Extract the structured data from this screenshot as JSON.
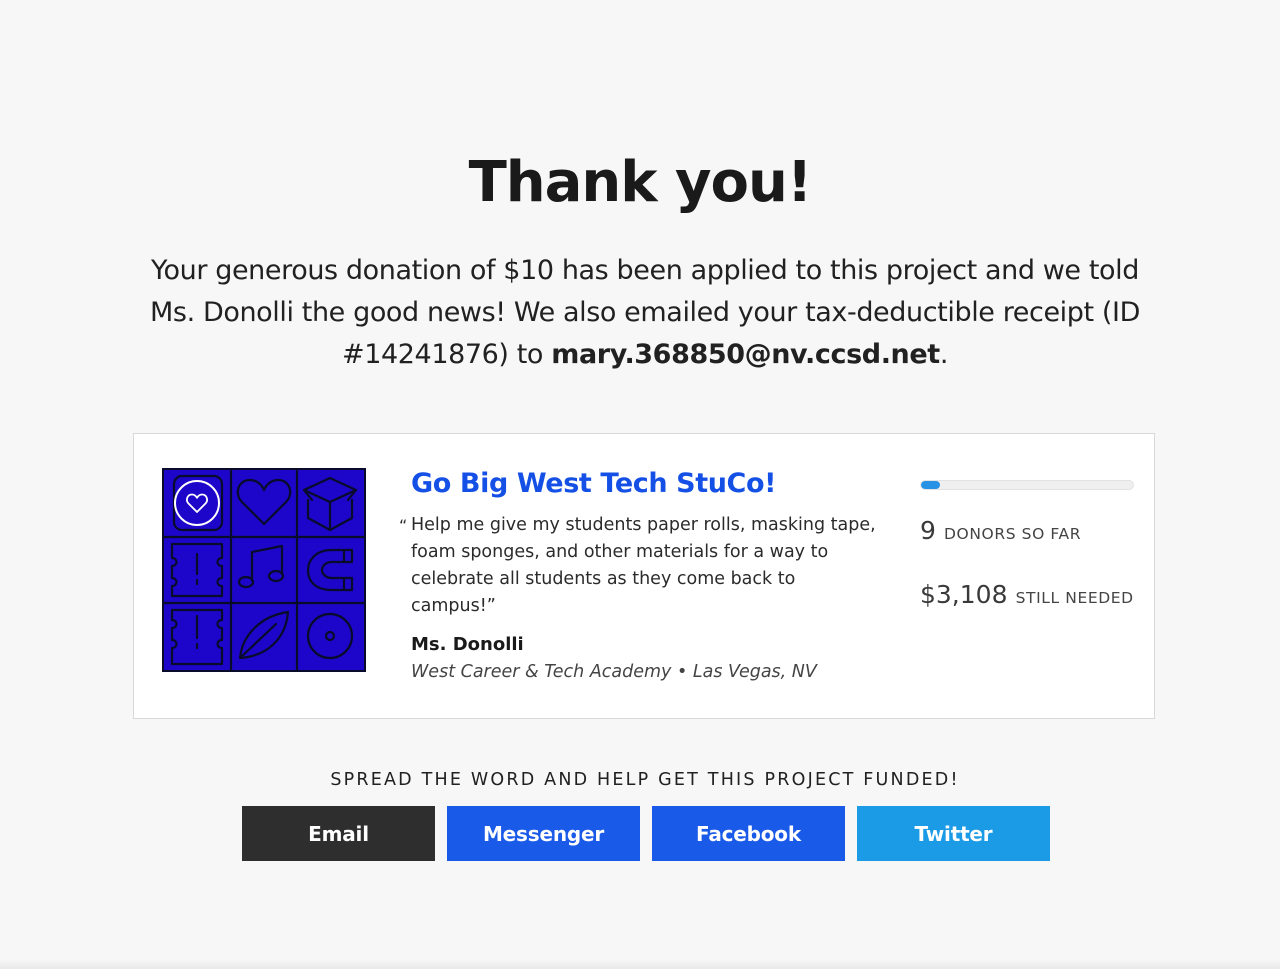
{
  "heading": "Thank you!",
  "message": {
    "text": "Your generous donation of $10 has been applied to this project and we told Ms. Donolli the good news! We also emailed your tax-deductible receipt (ID #14241876) to ",
    "email": "mary.368850@nv.ccsd.net",
    "end": "."
  },
  "project": {
    "title": "Go Big West Tech StuCo!",
    "open_quote": "“",
    "quote": "Help me give my students paper rolls, masking tape, foam sponges, and other materials for a way to celebrate all students as they come back to campus!”",
    "teacher": "Ms. Donolli",
    "school": "West Career & Tech Academy • Las Vegas, NV",
    "image_icon": "project-category-pattern",
    "favorite_icon": "heart-icon",
    "progress_fraction": 0.09,
    "donors_count": "9",
    "donors_label": "DONORS SO FAR",
    "needed_amount": "$3,108",
    "needed_label": "STILL NEEDED"
  },
  "share": {
    "heading": "SPREAD THE WORD AND HELP GET THIS PROJECT FUNDED!",
    "buttons": {
      "email": "Email",
      "messenger": "Messenger",
      "facebook": "Facebook",
      "twitter": "Twitter"
    }
  },
  "colors": {
    "background": "#f7f7f7",
    "accent_link": "#1450e6",
    "image_bg": "#1d06c9",
    "progress": "#2592e6",
    "email_btn": "#2e2e2e",
    "messenger_btn": "#1a5ae8",
    "facebook_btn": "#1a5ae8",
    "twitter_btn": "#1b9ae6"
  }
}
